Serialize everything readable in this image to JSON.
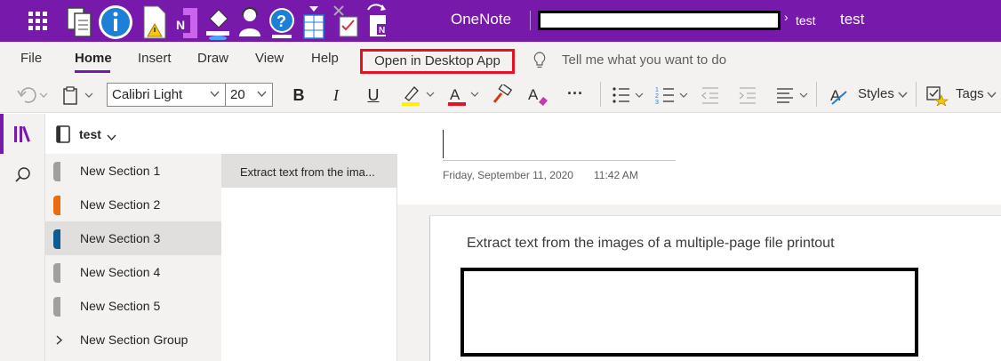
{
  "titlebar": {
    "app_name": "OneNote",
    "breadcrumb_notebook": "test",
    "breadcrumb_page": "test",
    "quick_icons": [
      "file-copy-icon",
      "info-icon",
      "document-warning-icon",
      "onenote-icon",
      "paint-bucket-icon",
      "support-agent-icon",
      "help-icon",
      "table-insert-icon",
      "checklist-icon",
      "sync-onenote-icon"
    ]
  },
  "tabs": {
    "items": [
      "File",
      "Home",
      "Insert",
      "Draw",
      "View",
      "Help"
    ],
    "open_desktop": "Open in Desktop App",
    "tell_me": "Tell me what you want to do"
  },
  "toolbar": {
    "font_name": "Calibri Light",
    "font_size": "20",
    "bold": "B",
    "italic": "I",
    "underline": "U",
    "font_color_letter": "A",
    "styles_label": "Styles",
    "tags_label": "Tags",
    "more": "···"
  },
  "notebook": {
    "name": "test",
    "sections": [
      {
        "label": "New Section 1",
        "color": "#a19f9d"
      },
      {
        "label": "New Section 2",
        "color": "#ea6c0c"
      },
      {
        "label": "New Section 3",
        "color": "#0f5a8f"
      },
      {
        "label": "New Section 4",
        "color": "#a19f9d"
      },
      {
        "label": "New Section 5",
        "color": "#a19f9d"
      },
      {
        "label": "New Section Group",
        "color": ""
      }
    ],
    "selected_section": "New Section 3",
    "pages": [
      {
        "label": "Extract text from the ima..."
      }
    ]
  },
  "page": {
    "date": "Friday, September 11, 2020",
    "time": "11:42 AM",
    "body_text": "Extract text from the images of a multiple-page file printout"
  },
  "colors": {
    "brand": "#7719aa",
    "ribbon": "#f3f2f1",
    "highlight": "#fff100",
    "font_color": "#e81123",
    "annotation": "#e81123"
  }
}
